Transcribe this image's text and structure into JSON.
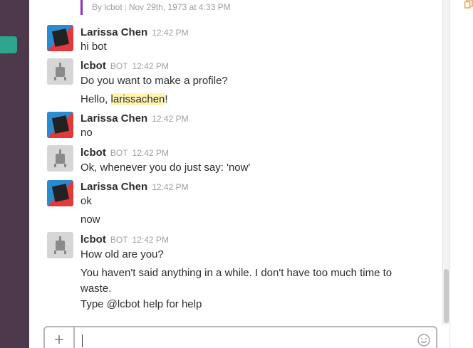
{
  "attachment": {
    "author": "By lcbot",
    "date": "Nov 29th, 1973 at 4:33 PM"
  },
  "messages": [
    {
      "sender": "Larissa Chen",
      "time": "12:42 PM",
      "is_bot": false,
      "lines": [
        "hi bot"
      ]
    },
    {
      "sender": "lcbot",
      "bot_tag": "BOT",
      "time": "12:42 PM",
      "is_bot": true,
      "lines": [
        "Do you want to make a profile?"
      ]
    },
    {
      "line_prefix": "Hello, ",
      "mention": "larissachen",
      "line_suffix": "!"
    },
    {
      "sender": "Larissa Chen",
      "time": "12:42 PM",
      "is_bot": false,
      "lines": [
        "no"
      ]
    },
    {
      "sender": "lcbot",
      "bot_tag": "BOT",
      "time": "12:42 PM",
      "is_bot": true,
      "lines": [
        "Ok, whenever you do just say: 'now'"
      ]
    },
    {
      "sender": "Larissa Chen",
      "time": "12:42 PM",
      "is_bot": false,
      "lines": [
        "ok",
        "now"
      ]
    },
    {
      "sender": "lcbot",
      "bot_tag": "BOT",
      "time": "12:42 PM",
      "is_bot": true,
      "lines": [
        "How old are you?",
        "You haven't said anything in a while. I don't have too much time to",
        "waste.",
        "Type @lcbot help for help"
      ]
    }
  ],
  "composer": {
    "plus_icon": "plus-icon",
    "emoji_icon": "smiley-icon"
  },
  "colors": {
    "sidebar": "#4d394b",
    "accent_teal": "#2fa58e",
    "attachment_bar": "#8f2ebf",
    "mention_highlight": "#fff3b0"
  }
}
